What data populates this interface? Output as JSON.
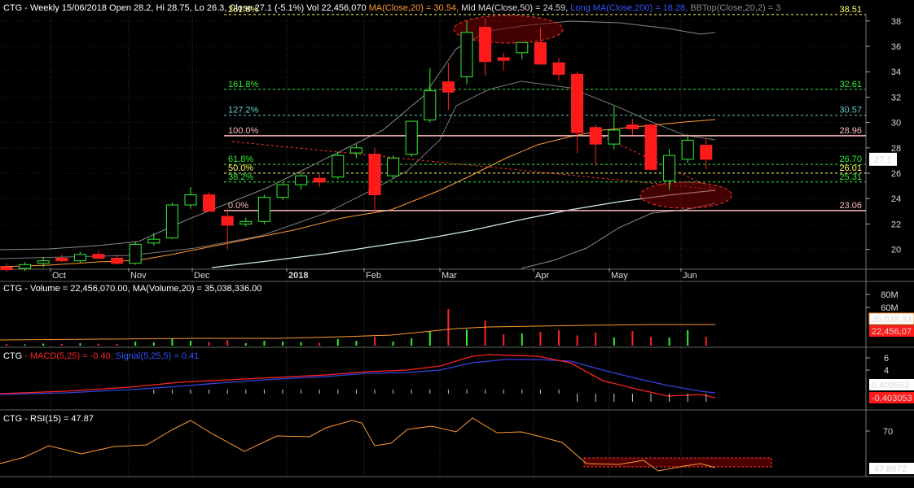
{
  "chart_data": [
    {
      "type": "candlestick",
      "header": {
        "symbol": "CTG",
        "summary": "- Weekly 15/06/2018 Open 28.2, Hi 28.75, Lo 26.3, Close 27.1 (-5.1%) Vol 22,456,070",
        "ma20": "MA(Close,20) = 30.54,",
        "ma50": "Mid MA(Close,50) = 24.59,",
        "ma200": "Long MA(Close,200) = 18.28,",
        "bbtop": "BBTop(Close,20,2) = 3"
      },
      "y_ticks": [
        "38",
        "36",
        "34",
        "32",
        "30",
        "28",
        "26",
        "24",
        "22",
        "20"
      ],
      "ylim": [
        18,
        39.5
      ],
      "month_labels": [
        "Oct",
        "Nov",
        "Dec",
        "2018",
        "Feb",
        "Mar",
        "Apr",
        "May",
        "Jun"
      ],
      "last_price_label": "27.1",
      "fib_levels": [
        {
          "label": "261.8%",
          "value_label": "38.51",
          "value": 38.51,
          "color": "#ffff66"
        },
        {
          "label": "161.8%",
          "value_label": "32.61",
          "value": 32.61,
          "color": "#33ee33"
        },
        {
          "label": "127.2%",
          "value_label": "30.57",
          "value": 30.57,
          "color": "#66cccc"
        },
        {
          "label": "100.0%",
          "value_label": "28.96",
          "value": 28.96,
          "color": "#ffbbbb"
        },
        {
          "label": "61.8%",
          "value_label": "26.70",
          "value": 26.7,
          "color": "#33ee33"
        },
        {
          "label": "50.0%",
          "value_label": "26.01",
          "value": 26.01,
          "color": "#ffff66"
        },
        {
          "label": "38.2%",
          "value_label": "25.31",
          "value": 25.31,
          "color": "#33ee33"
        },
        {
          "label": "0.0%",
          "value_label": "23.06",
          "value": 23.06,
          "color": "#ffbbbb"
        }
      ],
      "candles": [
        {
          "o": 18.6,
          "h": 18.9,
          "l": 18.2,
          "c": 18.4
        },
        {
          "o": 18.5,
          "h": 19.0,
          "l": 18.3,
          "c": 18.8
        },
        {
          "o": 18.9,
          "h": 19.4,
          "l": 18.6,
          "c": 19.1
        },
        {
          "o": 19.3,
          "h": 19.6,
          "l": 19.0,
          "c": 19.1
        },
        {
          "o": 19.1,
          "h": 19.8,
          "l": 18.9,
          "c": 19.6
        },
        {
          "o": 19.6,
          "h": 19.9,
          "l": 19.2,
          "c": 19.3
        },
        {
          "o": 19.3,
          "h": 19.6,
          "l": 18.8,
          "c": 18.9
        },
        {
          "o": 18.9,
          "h": 20.6,
          "l": 18.8,
          "c": 20.4
        },
        {
          "o": 20.5,
          "h": 21.3,
          "l": 20.3,
          "c": 20.8
        },
        {
          "o": 20.9,
          "h": 23.7,
          "l": 20.8,
          "c": 23.5
        },
        {
          "o": 23.5,
          "h": 24.9,
          "l": 23.2,
          "c": 24.3
        },
        {
          "o": 24.3,
          "h": 24.5,
          "l": 23.0,
          "c": 23.0
        },
        {
          "o": 22.6,
          "h": 23.2,
          "l": 20.0,
          "c": 21.9
        },
        {
          "o": 22.0,
          "h": 22.5,
          "l": 21.8,
          "c": 22.2
        },
        {
          "o": 22.2,
          "h": 24.3,
          "l": 22.0,
          "c": 24.1
        },
        {
          "o": 24.1,
          "h": 25.3,
          "l": 23.9,
          "c": 25.1
        },
        {
          "o": 25.1,
          "h": 26.1,
          "l": 24.7,
          "c": 25.8
        },
        {
          "o": 25.6,
          "h": 26.0,
          "l": 24.9,
          "c": 25.3
        },
        {
          "o": 25.7,
          "h": 27.7,
          "l": 25.5,
          "c": 27.4
        },
        {
          "o": 27.6,
          "h": 28.3,
          "l": 27.2,
          "c": 28.0
        },
        {
          "o": 27.5,
          "h": 28.0,
          "l": 22.9,
          "c": 24.3
        },
        {
          "o": 25.8,
          "h": 27.4,
          "l": 25.6,
          "c": 27.2
        },
        {
          "o": 27.5,
          "h": 29.6,
          "l": 27.3,
          "c": 30.1
        },
        {
          "o": 30.2,
          "h": 34.3,
          "l": 30.0,
          "c": 32.5
        },
        {
          "o": 33.2,
          "h": 34.7,
          "l": 31.0,
          "c": 32.4
        },
        {
          "o": 33.6,
          "h": 38.0,
          "l": 33.0,
          "c": 37.1
        },
        {
          "o": 37.5,
          "h": 38.2,
          "l": 33.7,
          "c": 34.8
        },
        {
          "o": 35.1,
          "h": 35.5,
          "l": 34.1,
          "c": 34.9
        },
        {
          "o": 35.5,
          "h": 36.3,
          "l": 35.0,
          "c": 36.3
        },
        {
          "o": 36.3,
          "h": 37.5,
          "l": 34.7,
          "c": 34.6
        },
        {
          "o": 34.7,
          "h": 35.1,
          "l": 33.3,
          "c": 33.8
        },
        {
          "o": 33.8,
          "h": 34.0,
          "l": 27.6,
          "c": 29.2
        },
        {
          "o": 29.6,
          "h": 29.8,
          "l": 26.6,
          "c": 28.3
        },
        {
          "o": 28.3,
          "h": 31.3,
          "l": 27.9,
          "c": 29.4
        },
        {
          "o": 29.8,
          "h": 30.3,
          "l": 29.0,
          "c": 29.5
        },
        {
          "o": 29.8,
          "h": 29.9,
          "l": 26.3,
          "c": 26.3
        },
        {
          "o": 25.4,
          "h": 27.9,
          "l": 24.7,
          "c": 27.4
        },
        {
          "o": 27.1,
          "h": 29.1,
          "l": 26.8,
          "c": 28.6
        },
        {
          "o": 28.2,
          "h": 28.75,
          "l": 26.3,
          "c": 27.1
        }
      ]
    },
    {
      "type": "bar",
      "header": {
        "symbol": "CTG",
        "summary": "- Volume = 22,456,070.00,",
        "ma": "MA(Volume,20) = 35,038,336.00"
      },
      "y_ticks": [
        "80M",
        "60M"
      ],
      "ma_value_label": "35,038,33",
      "last_value_label": "22,456,07",
      "values": [
        4,
        3,
        5,
        4,
        6,
        5,
        4,
        10,
        8,
        18,
        12,
        9,
        14,
        6,
        12,
        10,
        9,
        7,
        16,
        12,
        22,
        10,
        18,
        35,
        90,
        40,
        62,
        28,
        30,
        34,
        38,
        25,
        32,
        20,
        36,
        22,
        20,
        38,
        22
      ]
    },
    {
      "type": "line",
      "header": {
        "symbol": "CTG",
        "macd": "- MACD(5,25) = -0.40,",
        "signal": "Signal(5,25,5) = 0.41"
      },
      "y_ticks": [
        "6",
        "4"
      ],
      "signal_label": "0.409593",
      "macd_label": "-0.403053"
    },
    {
      "type": "line",
      "header": {
        "symbol": "CTG",
        "rsi": "- RSI(15) = 47.87"
      },
      "y_ticks": [
        "70"
      ],
      "last_label": "47.8672"
    }
  ]
}
